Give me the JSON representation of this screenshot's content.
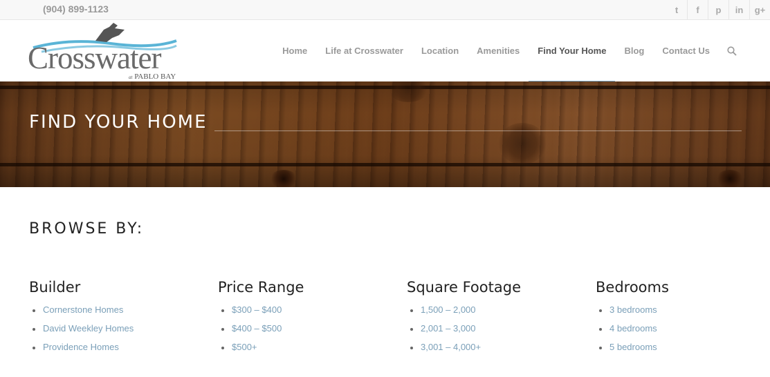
{
  "topbar": {
    "phone": "(904) 899-1123",
    "social": [
      {
        "icon": "twitter-icon",
        "glyph": "t"
      },
      {
        "icon": "facebook-icon",
        "glyph": "f"
      },
      {
        "icon": "pinterest-icon",
        "glyph": "p"
      },
      {
        "icon": "linkedin-icon",
        "glyph": "in"
      },
      {
        "icon": "google-plus-icon",
        "glyph": "g+"
      }
    ]
  },
  "logo": {
    "name": "Crosswater",
    "sub_at": "at",
    "sub": "PABLO BAY",
    "colors": {
      "water": "#5ab4d6",
      "text": "#6a6a6a"
    }
  },
  "nav": {
    "items": [
      "Home",
      "Life at Crosswater",
      "Location",
      "Amenities",
      "Find Your Home",
      "Blog",
      "Contact Us"
    ],
    "active": "Find Your Home",
    "accent": "#7aa7c7"
  },
  "hero": {
    "title": "FIND YOUR HOME"
  },
  "browse": {
    "title": "BROWSE BY:",
    "columns": [
      {
        "heading": "Builder",
        "links": [
          "Cornerstone Homes",
          "David Weekley Homes",
          "Providence Homes"
        ]
      },
      {
        "heading": "Price Range",
        "links": [
          "$300 – $400",
          "$400 – $500",
          "$500+"
        ]
      },
      {
        "heading": "Square Footage",
        "links": [
          "1,500 – 2,000",
          "2,001 – 3,000",
          "3,001 – 4,000+"
        ]
      },
      {
        "heading": "Bedrooms",
        "links": [
          "3 bedrooms",
          "4 bedrooms",
          "5 bedrooms"
        ]
      }
    ],
    "link_color": "#7a9fb8"
  }
}
